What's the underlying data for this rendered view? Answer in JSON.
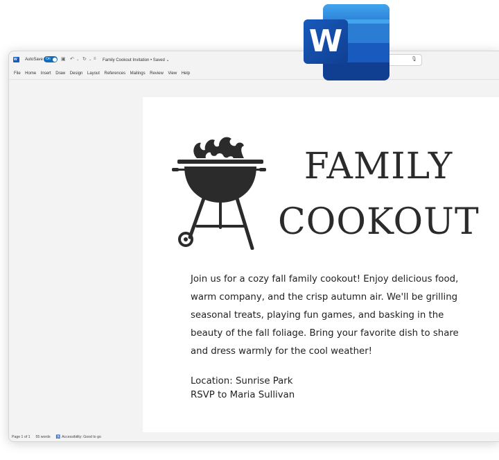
{
  "titlebar": {
    "autosave_label": "AutoSave",
    "toggle_label": "On",
    "document_title": "Family Cookout Invitation • Saved ⌄"
  },
  "menu": [
    "File",
    "Home",
    "Insert",
    "Draw",
    "Design",
    "Layout",
    "References",
    "Mailings",
    "Review",
    "View",
    "Help"
  ],
  "document": {
    "title_line1": "FAMILY",
    "title_line2": "COOKOUT",
    "body": "Join us for a cozy fall family cookout! Enjoy delicious food, warm company, and the crisp autumn air. We'll be grilling seasonal treats, playing fun games, and basking in the beauty of the fall foliage. Bring your favorite dish to share and dress warmly for the cool weather!",
    "location": "Location: Sunrise Park",
    "rsvp": "RSVP to Maria Sullivan"
  },
  "status": {
    "page": "Page 1 of 1",
    "words": "55 words",
    "accessibility": "Accessibility: Good to go"
  },
  "logo_letter": "W",
  "colors": {
    "accent": "#0f6cbd",
    "word_blue": "#185abd",
    "text": "#2b2b2b"
  }
}
